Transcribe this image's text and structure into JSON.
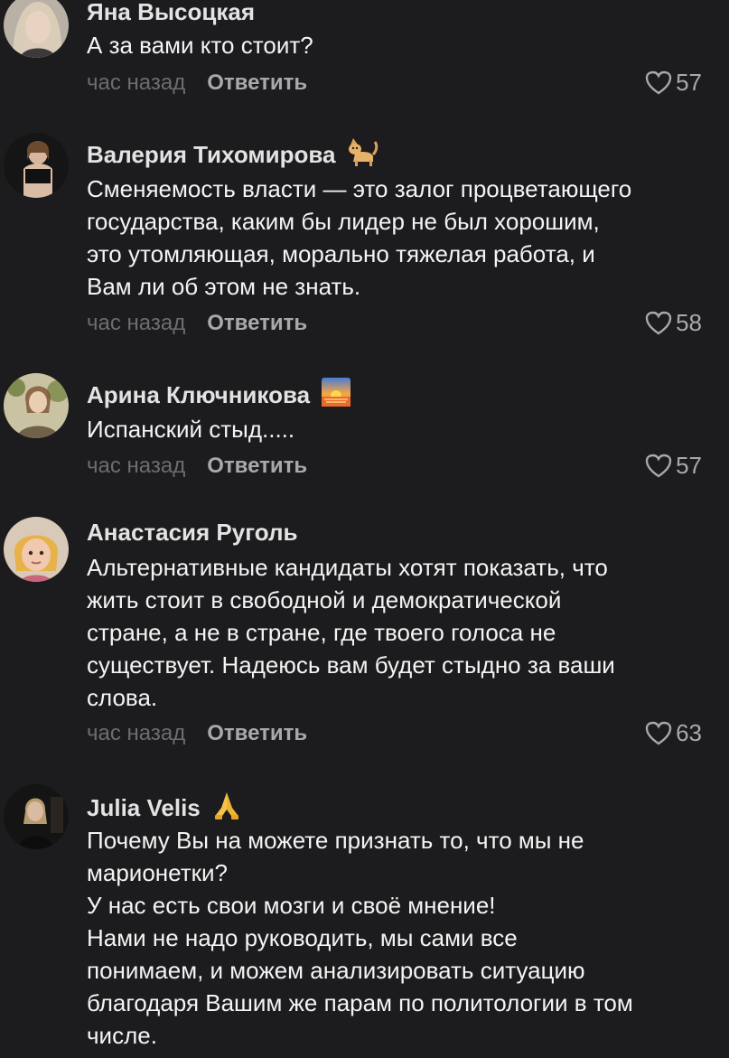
{
  "comments": [
    {
      "author": "Яна Высоцкая",
      "lines": [
        "А за вами кто стоит?"
      ],
      "time": "час назад",
      "reply": "Ответить",
      "likes": "57",
      "avatar_icon": "avatar-photo"
    },
    {
      "author": "Валерия Тихомирова",
      "emoji": "cat-emoji",
      "lines": [
        "Сменяемость власти — это залог процветающего",
        "государства, каким бы лидер не был хорошим,",
        "это утомляющая, морально тяжелая работа, и",
        "Вам ли об этом не знать."
      ],
      "time": "час назад",
      "reply": "Ответить",
      "likes": "58",
      "avatar_icon": "avatar-photo"
    },
    {
      "author": "Арина Ключникова",
      "emoji": "sunrise-emoji",
      "lines": [
        "Испанский стыд....."
      ],
      "time": "час назад",
      "reply": "Ответить",
      "likes": "57",
      "avatar_icon": "avatar-photo"
    },
    {
      "author": "Анастасия Руголь",
      "lines": [
        "Альтернативные кандидаты хотят показать, что",
        "жить стоит в свободной и демократической",
        "стране, а не в стране, где твоего голоса не",
        "существует. Надеюсь вам будет стыдно за ваши",
        "слова."
      ],
      "time": "час назад",
      "reply": "Ответить",
      "likes": "63",
      "avatar_icon": "avatar-photo"
    },
    {
      "author": "Julia Velis",
      "emoji": "folded-hands-emoji",
      "lines": [
        "Почему Вы на можете признать то, что мы не",
        "марионетки?",
        "У нас есть свои мозги и своё мнение!",
        "Нами не надо руководить, мы сами все",
        "понимаем, и можем анализировать ситуацию",
        "благодаря Вашим же парам по политологии в том",
        "числе."
      ],
      "avatar_icon": "avatar-photo"
    }
  ],
  "colors": {
    "background": "#1c1c1e",
    "author": "#e3e3e3",
    "text": "#f4f4f4",
    "muted": "#6d6d70",
    "action": "#a9a9ad"
  }
}
